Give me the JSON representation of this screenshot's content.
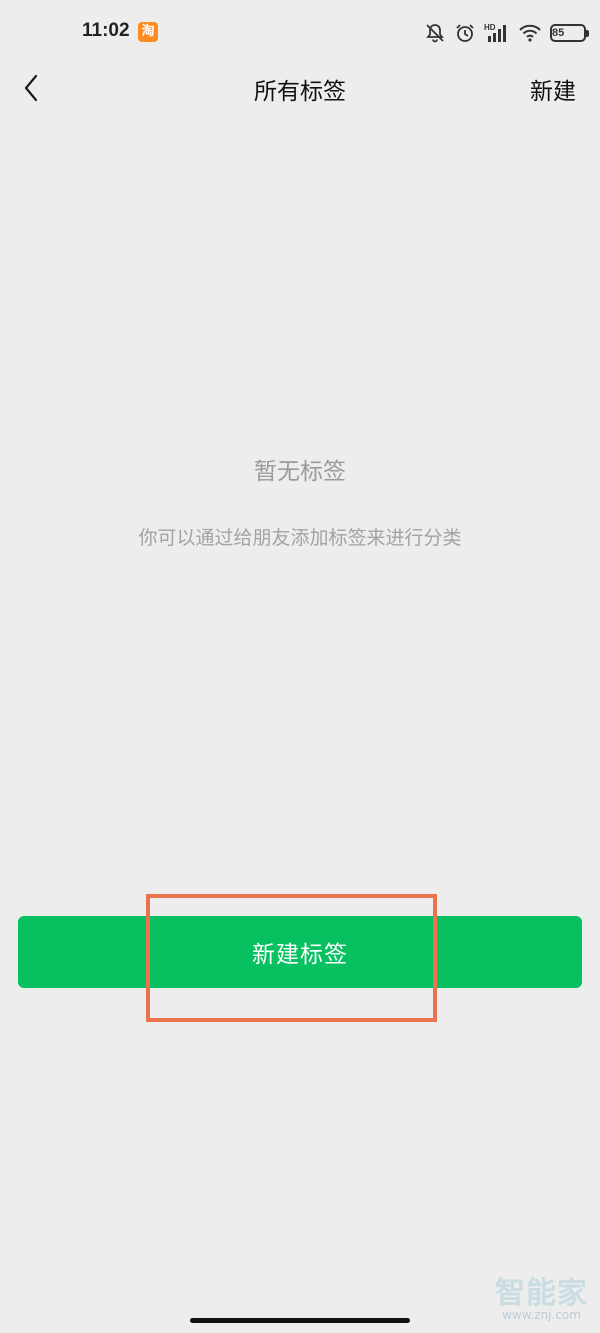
{
  "status_bar": {
    "time": "11:02",
    "app_icon_glyph": "淘",
    "battery": "85",
    "icons": [
      "taobao-icon",
      "mute-bell-icon",
      "alarm-icon",
      "hd-signal-icon",
      "wifi-icon",
      "battery-icon"
    ]
  },
  "nav": {
    "title": "所有标签",
    "action_label": "新建"
  },
  "empty_state": {
    "title": "暂无标签",
    "description": "你可以通过给朋友添加标签来进行分类"
  },
  "primary_button": {
    "label": "新建标签"
  },
  "watermark": {
    "main": "智能家",
    "sub": "www.znj.com"
  },
  "colors": {
    "background": "#ededed",
    "primary_green": "#07c160",
    "highlight": "#e8734d"
  }
}
